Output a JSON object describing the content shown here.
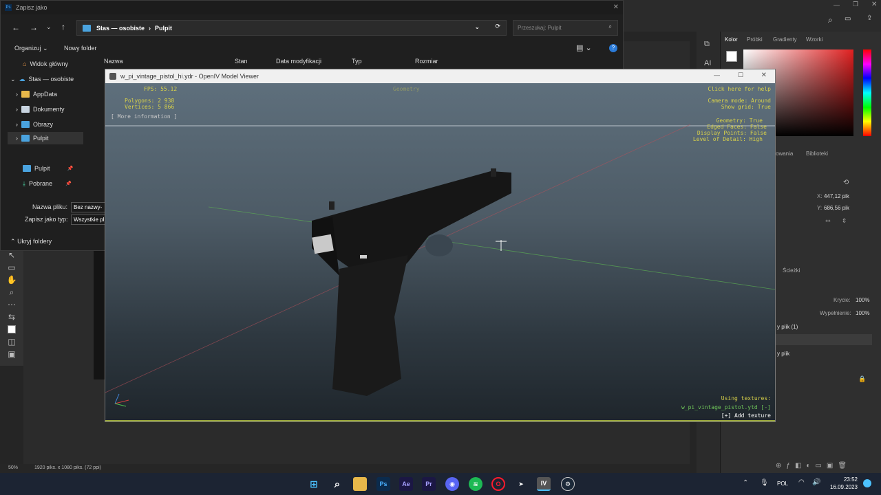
{
  "photoshop": {
    "tabs": [
      "Kolor",
      "Próbki",
      "Gradienty",
      "Wzorki"
    ],
    "lower_tabs": [
      "owania",
      "Biblioteki"
    ],
    "coord_x_label": "X:",
    "coord_x": "447,12 pik",
    "coord_y_label": "Y:",
    "coord_y": "686,56 pik",
    "layers_tab": "Ścieżki",
    "opacity_label": "Krycie:",
    "opacity": "100%",
    "fill_label": "Wypełnienie:",
    "fill": "100%",
    "layer1": "y plik (1)",
    "layer2": "y plik",
    "zoom": "50%",
    "doc_info": "1920 piks. x 1080 piks. (72 ppi)",
    "ai_label": "AI"
  },
  "save_dialog": {
    "title": "Zapisz jako",
    "breadcrumb": [
      "Stas — osobiste",
      "Pulpit"
    ],
    "search_placeholder": "Przeszukaj: Pulpit",
    "organize": "Organizuj",
    "new_folder": "Nowy folder",
    "columns": [
      "Nazwa",
      "Stan",
      "Data modyfikacji",
      "Typ",
      "Rozmiar"
    ],
    "nav": [
      {
        "label": "Widok główny"
      },
      {
        "label": "Stas — osobiste"
      },
      {
        "label": "AppData"
      },
      {
        "label": "Dokumenty"
      },
      {
        "label": "Obrazy"
      },
      {
        "label": "Pulpit"
      },
      {
        "label": "Pulpit"
      },
      {
        "label": "Pobrane"
      }
    ],
    "filename_label": "Nazwa pliku:",
    "filename": "Bez nazwy-",
    "type_label": "Zapisz jako typ:",
    "type_value": "Wszystkie pl",
    "hide_folders": "Ukryj foldery"
  },
  "viewer": {
    "title": "w_pi_vintage_pistol_hi.ydr - OpenIV Model Viewer",
    "fps": "FPS: 55.12",
    "geometry_tag": "Geometry",
    "polygons": "Polygons: 2 938",
    "vertices": "Vertices: 5 866",
    "more_info": "[ More information ]",
    "help": "Click here for help",
    "camera_mode": "Camera mode: Around",
    "show_grid": "Show grid: True",
    "geometry": "Geometry: True",
    "edged_faces": "Edged Faces: False",
    "display_points": "Display Points: False",
    "lod": "Level of Detail: High",
    "using_textures": "Using textures:",
    "texture_file": "w_pi_vintage_pistol.ytd [-]",
    "add_texture": "[+] Add texture"
  },
  "taskbar": {
    "apps": [
      "Windows",
      "Search",
      "Explorer",
      "Ps",
      "Ae",
      "Pr",
      "Discord",
      "Spotify",
      "Opera",
      "Telegram",
      "OpenIV",
      "Steam"
    ],
    "lang": "POL",
    "time": "23:52",
    "date": "16.09.2023"
  }
}
